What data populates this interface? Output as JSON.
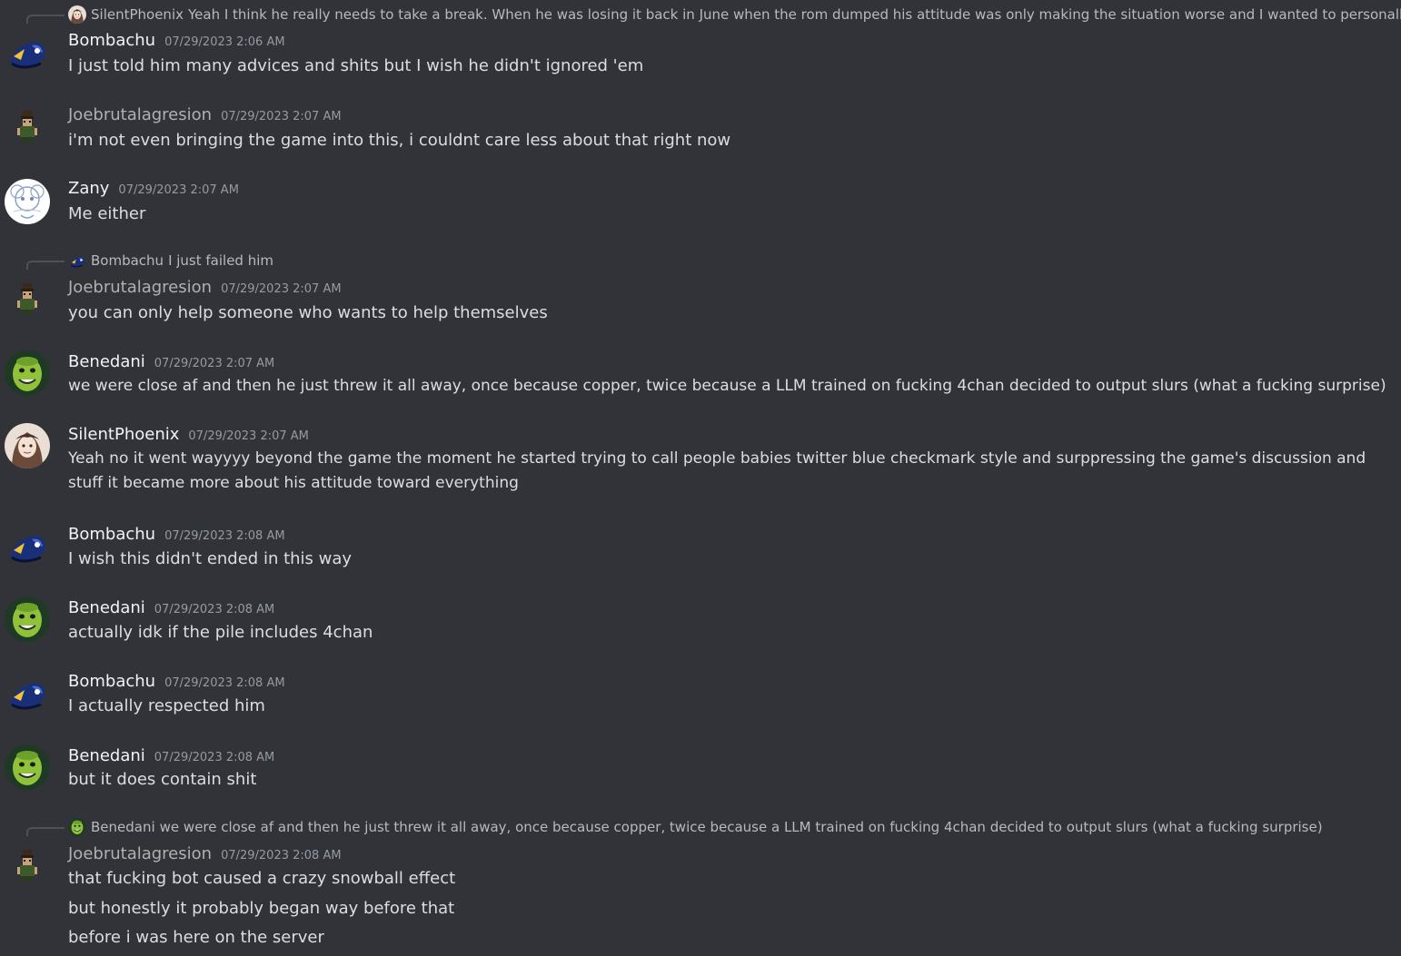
{
  "colors": {
    "background": "#313338",
    "text": "#dbdee1",
    "muted": "#949ba4",
    "username_default": "#f2f3f5",
    "username_joe": "#b0b0b0"
  },
  "messages": [
    {
      "reply": {
        "author": "SilentPhoenix",
        "text": "Yeah I think he really needs to take a break. When he was losing it back in June when the rom dumped his attitude was only making the situation worse and I wanted to personally tal",
        "avatar_icon": "silentphoenix-avatar-icon"
      },
      "author": "Bombachu",
      "timestamp": "07/29/2023 2:06 AM",
      "avatar_icon": "bombachu-avatar-icon",
      "lines": [
        "I just told him many advices and shits but I wish he didn't ignored 'em"
      ]
    },
    {
      "author": "Joebrutalagresion",
      "timestamp": "07/29/2023 2:07 AM",
      "avatar_icon": "joebrutalagresion-avatar-icon",
      "lines": [
        "i'm not even bringing the game into this, i couldnt care less about that right now"
      ]
    },
    {
      "author": "Zany",
      "timestamp": "07/29/2023 2:07 AM",
      "avatar_icon": "zany-avatar-icon",
      "lines": [
        "Me either"
      ]
    },
    {
      "reply": {
        "author": "Bombachu",
        "text": "I just failed him",
        "avatar_icon": "bombachu-avatar-icon"
      },
      "author": "Joebrutalagresion",
      "timestamp": "07/29/2023 2:07 AM",
      "avatar_icon": "joebrutalagresion-avatar-icon",
      "lines": [
        "you can only help someone who wants to help themselves"
      ]
    },
    {
      "author": "Benedani",
      "timestamp": "07/29/2023 2:07 AM",
      "avatar_icon": "benedani-avatar-icon",
      "lines": [
        "we were close af and then he just threw it all away, once because copper, twice because a LLM trained on fucking 4chan decided to output slurs (what a fucking surprise)"
      ]
    },
    {
      "author": "SilentPhoenix",
      "timestamp": "07/29/2023 2:07 AM",
      "avatar_icon": "silentphoenix-avatar-icon",
      "lines": [
        "Yeah no it went wayyyy beyond the game the moment he started trying to call people babies twitter blue checkmark style and surppressing the game's discussion and stuff it became more about his attitude toward everything"
      ]
    },
    {
      "author": "Bombachu",
      "timestamp": "07/29/2023 2:08 AM",
      "avatar_icon": "bombachu-avatar-icon",
      "lines": [
        "I wish this didn't ended in this way"
      ]
    },
    {
      "author": "Benedani",
      "timestamp": "07/29/2023 2:08 AM",
      "avatar_icon": "benedani-avatar-icon",
      "lines": [
        "actually idk if the pile includes 4chan"
      ]
    },
    {
      "author": "Bombachu",
      "timestamp": "07/29/2023 2:08 AM",
      "avatar_icon": "bombachu-avatar-icon",
      "lines": [
        "I actually respected him"
      ]
    },
    {
      "author": "Benedani",
      "timestamp": "07/29/2023 2:08 AM",
      "avatar_icon": "benedani-avatar-icon",
      "lines": [
        "but it does contain shit"
      ]
    },
    {
      "reply": {
        "author": "Benedani",
        "text": "we were close af and then he just threw it all away, once because copper, twice because a LLM trained on fucking 4chan decided to output slurs (what a fucking surprise)",
        "avatar_icon": "benedani-avatar-icon"
      },
      "author": "Joebrutalagresion",
      "timestamp": "07/29/2023 2:08 AM",
      "avatar_icon": "joebrutalagresion-avatar-icon",
      "lines": [
        "that fucking bot caused a crazy snowball effect",
        "but honestly it probably began way before that",
        "before i was here on the server"
      ]
    }
  ]
}
